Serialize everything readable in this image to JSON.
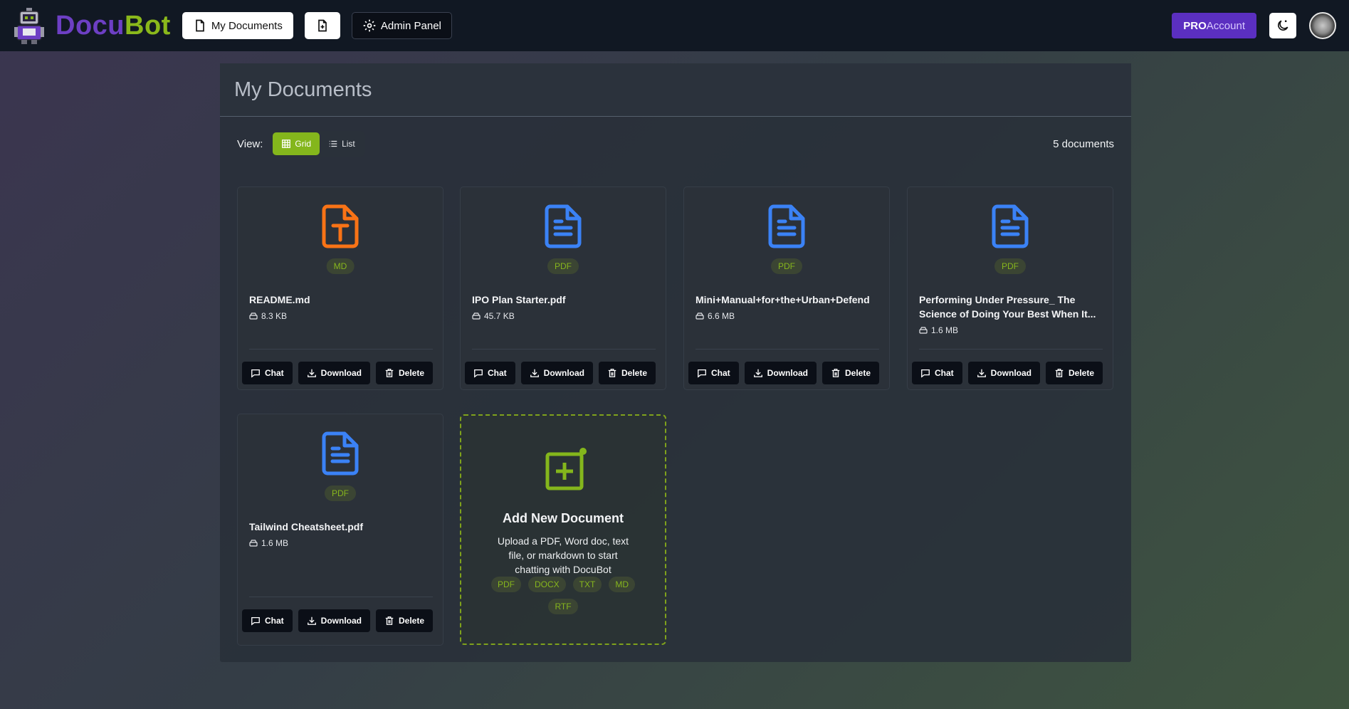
{
  "brand": {
    "part1": "Docu",
    "part2": "Bot"
  },
  "nav": {
    "my_documents": "My Documents",
    "admin_panel": "Admin Panel"
  },
  "account": {
    "pro": "PRO",
    "account": "Account"
  },
  "page": {
    "title": "My Documents",
    "view_label": "View:",
    "view_grid": "Grid",
    "view_list": "List",
    "doc_count": "5 documents"
  },
  "actions": {
    "chat": "Chat",
    "download": "Download",
    "delete": "Delete"
  },
  "documents": [
    {
      "name": "README.md",
      "type": "MD",
      "size": "8.3 KB",
      "icon": "markdown-file-icon",
      "color": "#f97316"
    },
    {
      "name": "IPO Plan Starter.pdf",
      "type": "PDF",
      "size": "45.7 KB",
      "icon": "pdf-file-icon",
      "color": "#3b82f6"
    },
    {
      "name": "Mini+Manual+for+the+Urban+Defend",
      "type": "PDF",
      "size": "6.6 MB",
      "icon": "pdf-file-icon",
      "color": "#3b82f6"
    },
    {
      "name": "Performing Under Pressure_ The Science of Doing Your Best When It...",
      "type": "PDF",
      "size": "1.6 MB",
      "icon": "pdf-file-icon",
      "color": "#3b82f6"
    },
    {
      "name": "Tailwind Cheatsheet.pdf",
      "type": "PDF",
      "size": "1.6 MB",
      "icon": "pdf-file-icon",
      "color": "#3b82f6"
    }
  ],
  "add_card": {
    "title": "Add New Document",
    "description": "Upload a PDF, Word doc, text file, or markdown to start chatting with DocuBot",
    "types": [
      "PDF",
      "DOCX",
      "TXT",
      "MD",
      "RTF"
    ]
  },
  "colors": {
    "accent": "#84b61c",
    "brand_purple": "#6d3fc4",
    "brand_green": "#8ab81b",
    "pro": "#5b2fc0"
  }
}
